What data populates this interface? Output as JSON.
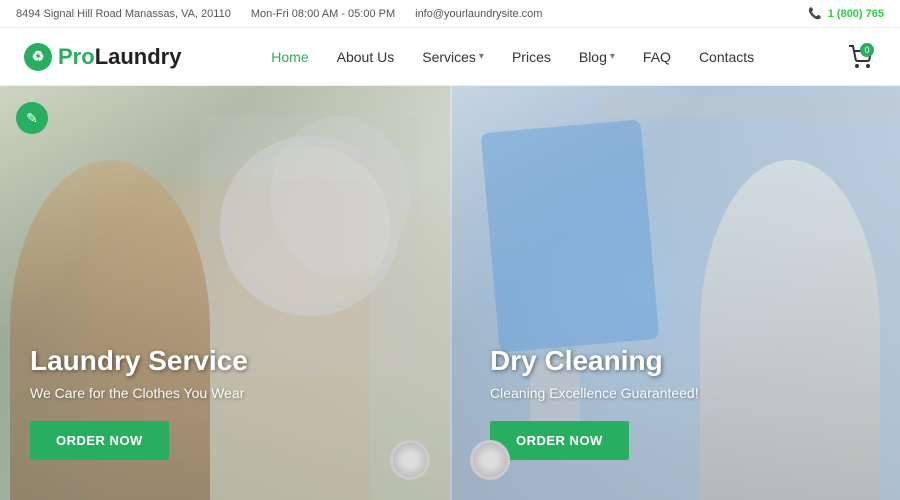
{
  "topbar": {
    "address": "8494 Signal Hill Road Manassas, VA, 20110",
    "hours": "Mon-Fri 08:00 AM - 05:00 PM",
    "email": "info@yourlaundrysite.com",
    "phone": "1 (800) 765",
    "phone_icon": "phone-icon"
  },
  "header": {
    "logo": {
      "pro": "Pro",
      "laundry": "Laundry",
      "icon_symbol": "♻"
    },
    "nav": [
      {
        "label": "Home",
        "active": true,
        "has_dropdown": false
      },
      {
        "label": "About Us",
        "active": false,
        "has_dropdown": false
      },
      {
        "label": "Services",
        "active": false,
        "has_dropdown": true
      },
      {
        "label": "Prices",
        "active": false,
        "has_dropdown": false
      },
      {
        "label": "Blog",
        "active": false,
        "has_dropdown": true
      },
      {
        "label": "FAQ",
        "active": false,
        "has_dropdown": false
      },
      {
        "label": "Contacts",
        "active": false,
        "has_dropdown": false
      }
    ],
    "cart_count": "0"
  },
  "hero": {
    "left": {
      "title": "Laundry Service",
      "subtitle": "We Care for the Clothes You Wear",
      "button_label": "Order Now"
    },
    "right": {
      "title": "Dry Cleaning",
      "subtitle": "Cleaning Excellence Guaranteed!",
      "button_label": "Order Now"
    },
    "edit_icon": "pencil-icon"
  }
}
